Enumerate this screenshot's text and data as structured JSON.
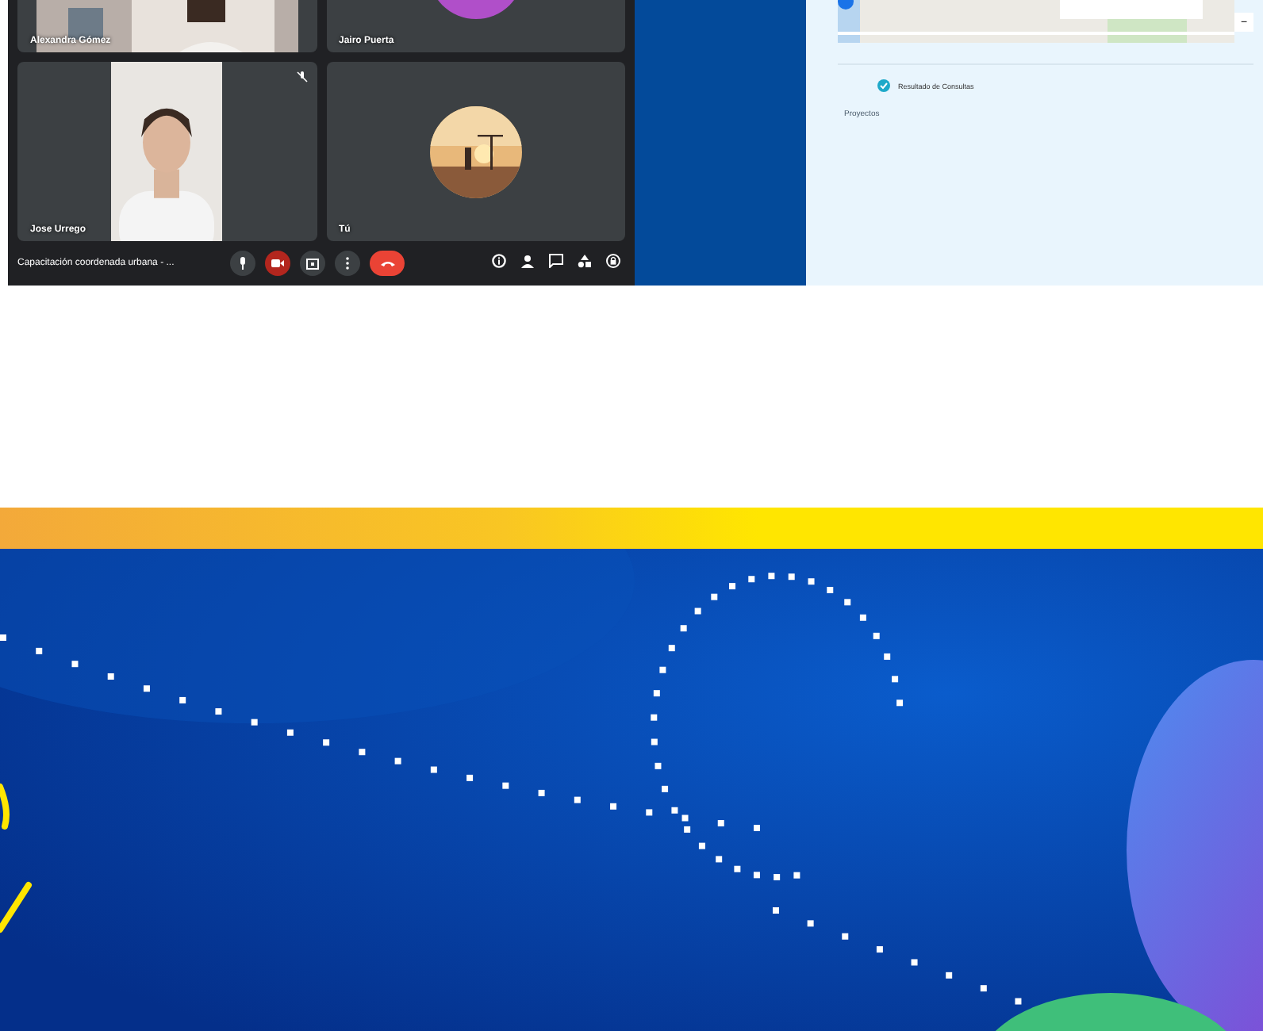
{
  "meeting": {
    "tiles": [
      {
        "name": "Alexandra Gómez",
        "kind": "video",
        "muted": false
      },
      {
        "name": "Jairo Puerta",
        "kind": "avatar",
        "muted": false
      },
      {
        "name": "Jose Urrego",
        "kind": "video",
        "muted": true
      },
      {
        "name": "Tú",
        "kind": "photo_avatar",
        "muted": false
      }
    ],
    "title": "Capacitación coordenada urbana - ...",
    "controls": [
      {
        "kind": "mic"
      },
      {
        "kind": "camera"
      },
      {
        "kind": "present"
      },
      {
        "kind": "more"
      },
      {
        "kind": "hangup"
      }
    ],
    "side_controls": [
      {
        "kind": "info"
      },
      {
        "kind": "people"
      },
      {
        "kind": "chat"
      },
      {
        "kind": "activities"
      },
      {
        "kind": "lock"
      }
    ]
  },
  "panel": {
    "zoom_out": "−",
    "layers": [
      {
        "label": "Resultado de Consultas",
        "checked": true
      }
    ],
    "section": "Proyectos"
  }
}
